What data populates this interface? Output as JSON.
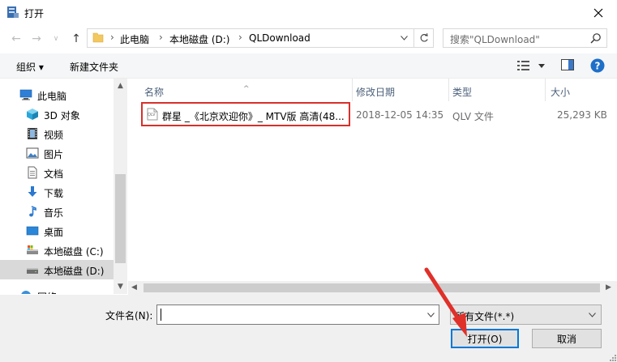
{
  "window": {
    "title": "打开"
  },
  "address": {
    "segments": [
      "此电脑",
      "本地磁盘 (D:)",
      "QLDownload"
    ]
  },
  "search": {
    "placeholder": "搜索\"QLDownload\""
  },
  "toolbar": {
    "organize_label": "组织 ▾",
    "new_folder_label": "新建文件夹"
  },
  "sidebar": {
    "items": [
      {
        "label": "此电脑",
        "icon": "computer-icon"
      },
      {
        "label": "3D 对象",
        "icon": "cube-3d-icon"
      },
      {
        "label": "视频",
        "icon": "video-icon"
      },
      {
        "label": "图片",
        "icon": "picture-icon"
      },
      {
        "label": "文档",
        "icon": "document-icon"
      },
      {
        "label": "下载",
        "icon": "download-icon"
      },
      {
        "label": "音乐",
        "icon": "music-icon"
      },
      {
        "label": "桌面",
        "icon": "desktop-icon"
      },
      {
        "label": "本地磁盘 (C:)",
        "icon": "drive-icon"
      },
      {
        "label": "本地磁盘 (D:)",
        "icon": "drive-icon"
      },
      {
        "label": "网络",
        "icon": "network-icon"
      }
    ],
    "selected_index": 9
  },
  "columns": {
    "name": "名称",
    "date": "修改日期",
    "type": "类型",
    "size": "大小"
  },
  "files": [
    {
      "name": "群星 _《北京欢迎你》_ MTV版 高清(48...",
      "date": "2018-12-05 14:35",
      "type": "QLV 文件",
      "size": "25,293 KB",
      "icon_text": "QLV"
    }
  ],
  "bottom": {
    "filename_label": "文件名(N):",
    "filename_value": "",
    "filetype_value": "所有文件(*.*)",
    "open_label": "打开(O)",
    "cancel_label": "取消"
  },
  "colors": {
    "highlight_box": "#d8302a",
    "primary_border": "#0078d7",
    "help_icon": "#1e6fc8"
  }
}
